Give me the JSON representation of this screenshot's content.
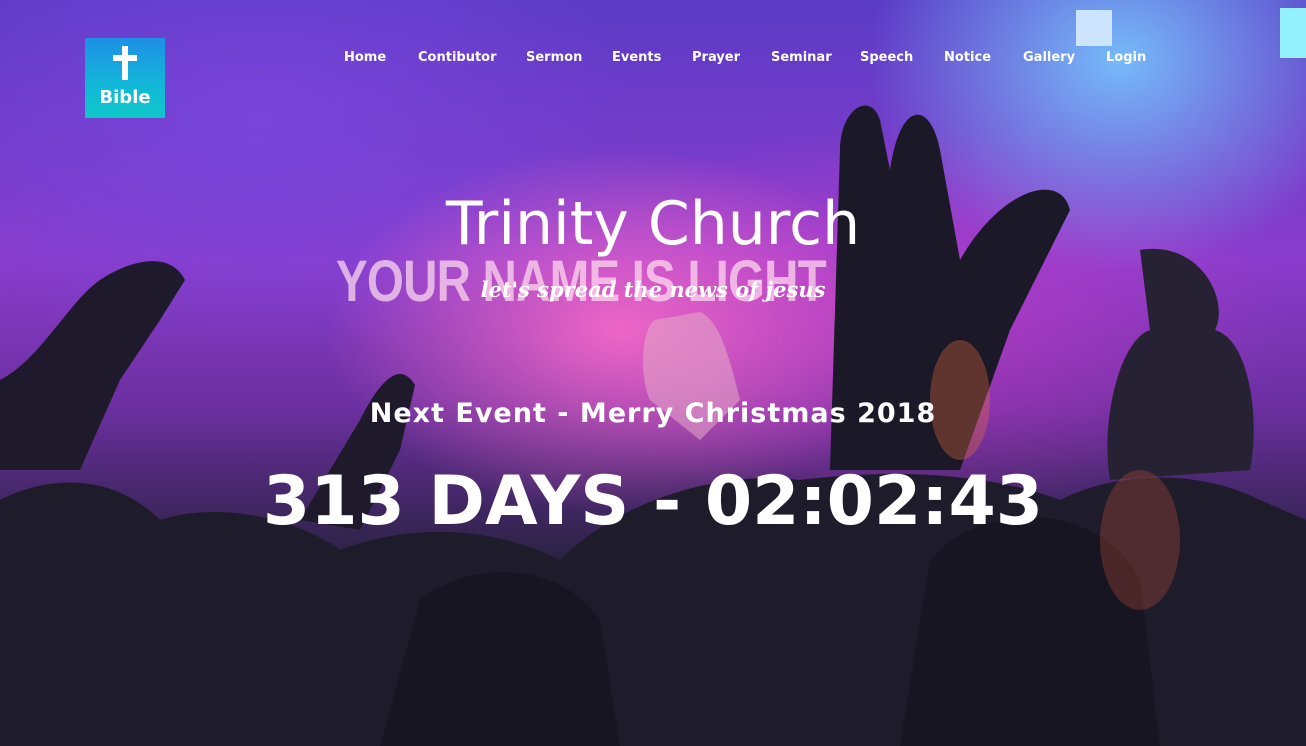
{
  "logo": {
    "text": "Bible",
    "icon": "cross-icon",
    "colors": [
      "#1e8fe6",
      "#0fc7c9"
    ]
  },
  "nav": {
    "items": [
      {
        "label": "Home"
      },
      {
        "label": "Contibutor"
      },
      {
        "label": "Sermon"
      },
      {
        "label": "Events"
      },
      {
        "label": "Prayer"
      },
      {
        "label": "Seminar"
      },
      {
        "label": "Speech"
      },
      {
        "label": "Notice"
      },
      {
        "label": "Gallery"
      },
      {
        "label": "Login"
      }
    ]
  },
  "hero": {
    "title": "Trinity Church",
    "tagline": "let's spread the news of jesus",
    "background_sign": "YOUR NAME IS LIGHT",
    "event": "Next Event - Merry Christmas 2018",
    "countdown": "313 DAYS - 02:02:43"
  }
}
